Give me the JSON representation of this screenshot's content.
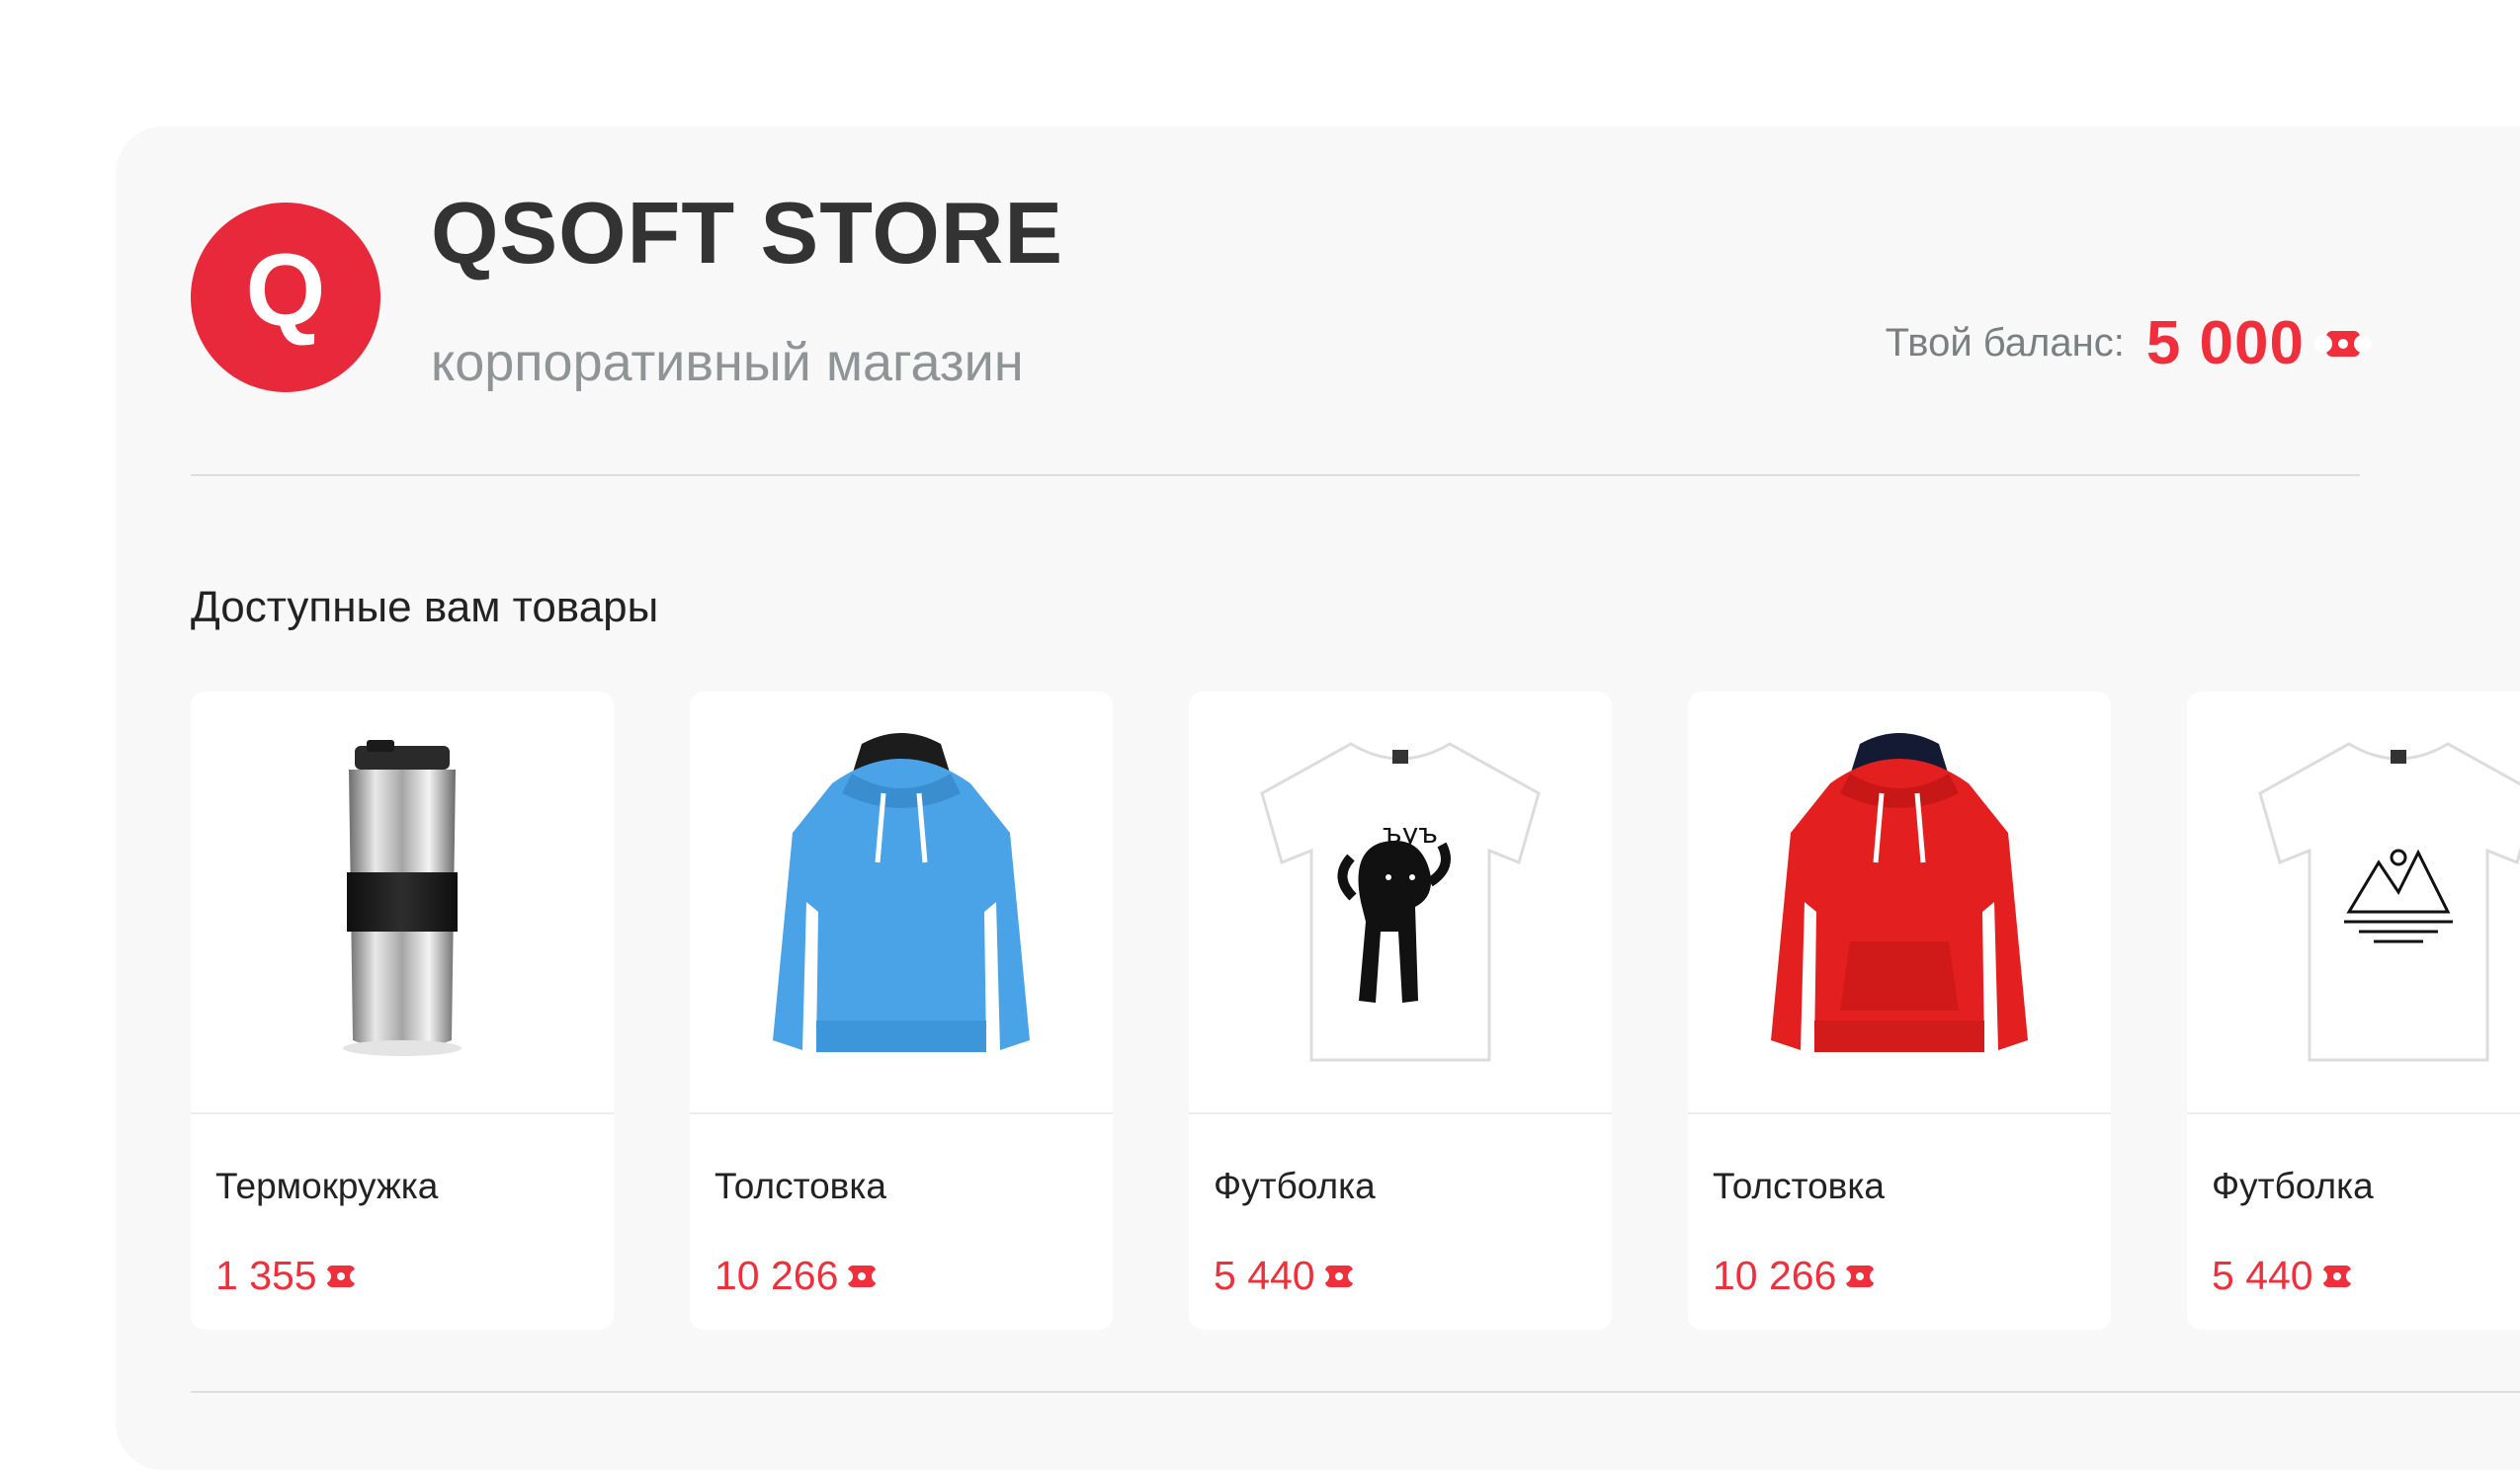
{
  "header": {
    "logo_letter": "Q",
    "title": "QSOFT STORE",
    "subtitle": "корпоративный магазин",
    "balance_label": "Твой баланс:",
    "balance_value": "5 000"
  },
  "section": {
    "title": "Доступные вам товары"
  },
  "products": [
    {
      "name": "Термокружка",
      "price": "1 355",
      "icon": "thermo-mug-icon"
    },
    {
      "name": "Толстовка",
      "price": "10 266",
      "icon": "blue-hoodie-icon"
    },
    {
      "name": "Футболка",
      "price": "5 440",
      "icon": "cat-tshirt-icon"
    },
    {
      "name": "Толстовка",
      "price": "10 266",
      "icon": "red-hoodie-icon"
    },
    {
      "name": "Футболка",
      "price": "5 440",
      "icon": "mountain-tshirt-icon"
    }
  ],
  "colors": {
    "brand": "#e8293b",
    "price": "#ef2f3c",
    "blue_hoodie": "#4aa3e6",
    "red_hoodie": "#e41f1f"
  }
}
